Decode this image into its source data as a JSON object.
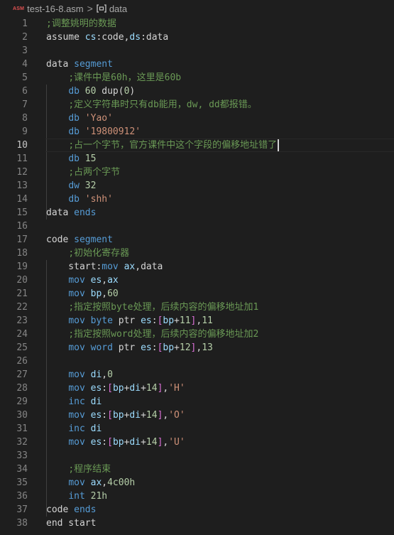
{
  "breadcrumb": {
    "file_icon": "ASM",
    "file": "test-16-8.asm",
    "separator": ">",
    "symbol": "data"
  },
  "colors": {
    "background": "#1e1e1e",
    "keyword": "#569cd6",
    "comment": "#6a9955",
    "number": "#b5cea8",
    "string": "#ce9178",
    "register": "#9cdcfe",
    "plain": "#d4d4d4",
    "bracket": "#da70d6",
    "line_number": "#858585"
  },
  "editor": {
    "current_line": 10,
    "lines": [
      {
        "n": "1",
        "tokens": [
          {
            "t": ";调整姚明的数据",
            "c": "cmt"
          }
        ]
      },
      {
        "n": "2",
        "tokens": [
          {
            "t": "assume ",
            "c": "pl"
          },
          {
            "t": "cs",
            "c": "reg"
          },
          {
            "t": ":code,",
            "c": "pl"
          },
          {
            "t": "ds",
            "c": "reg"
          },
          {
            "t": ":data",
            "c": "pl"
          }
        ]
      },
      {
        "n": "3",
        "tokens": []
      },
      {
        "n": "4",
        "tokens": [
          {
            "t": "data ",
            "c": "pl"
          },
          {
            "t": "segment",
            "c": "kw"
          }
        ]
      },
      {
        "n": "5",
        "tokens": [
          {
            "t": "    ",
            "c": "pl"
          },
          {
            "t": ";课件中是60h，这里是60b",
            "c": "cmt"
          }
        ]
      },
      {
        "n": "6",
        "tokens": [
          {
            "t": "    ",
            "c": "pl"
          },
          {
            "t": "db",
            "c": "kw"
          },
          {
            "t": " ",
            "c": "pl"
          },
          {
            "t": "60",
            "c": "num"
          },
          {
            "t": " dup(",
            "c": "pl"
          },
          {
            "t": "0",
            "c": "num"
          },
          {
            "t": ")",
            "c": "pl"
          }
        ]
      },
      {
        "n": "7",
        "tokens": [
          {
            "t": "    ",
            "c": "pl"
          },
          {
            "t": ";定义字符串时只有db能用，dw, dd都报错。",
            "c": "cmt"
          }
        ]
      },
      {
        "n": "8",
        "tokens": [
          {
            "t": "    ",
            "c": "pl"
          },
          {
            "t": "db",
            "c": "kw"
          },
          {
            "t": " ",
            "c": "pl"
          },
          {
            "t": "'Yao'",
            "c": "str"
          }
        ]
      },
      {
        "n": "9",
        "tokens": [
          {
            "t": "    ",
            "c": "pl"
          },
          {
            "t": "db",
            "c": "kw"
          },
          {
            "t": " ",
            "c": "pl"
          },
          {
            "t": "'19800912'",
            "c": "str"
          }
        ]
      },
      {
        "n": "10",
        "tokens": [
          {
            "t": "    ",
            "c": "pl"
          },
          {
            "t": ";占一个字节，官方课件中这个字段的偏移地址错了",
            "c": "cmt"
          }
        ],
        "cursor": true
      },
      {
        "n": "11",
        "tokens": [
          {
            "t": "    ",
            "c": "pl"
          },
          {
            "t": "db",
            "c": "kw"
          },
          {
            "t": " ",
            "c": "pl"
          },
          {
            "t": "15",
            "c": "num"
          }
        ]
      },
      {
        "n": "12",
        "tokens": [
          {
            "t": "    ",
            "c": "pl"
          },
          {
            "t": ";占两个字节",
            "c": "cmt"
          }
        ]
      },
      {
        "n": "13",
        "tokens": [
          {
            "t": "    ",
            "c": "pl"
          },
          {
            "t": "dw",
            "c": "kw"
          },
          {
            "t": " ",
            "c": "pl"
          },
          {
            "t": "32",
            "c": "num"
          }
        ]
      },
      {
        "n": "14",
        "tokens": [
          {
            "t": "    ",
            "c": "pl"
          },
          {
            "t": "db",
            "c": "kw"
          },
          {
            "t": " ",
            "c": "pl"
          },
          {
            "t": "'shh'",
            "c": "str"
          }
        ]
      },
      {
        "n": "15",
        "tokens": [
          {
            "t": "data ",
            "c": "pl"
          },
          {
            "t": "ends",
            "c": "kw"
          }
        ]
      },
      {
        "n": "16",
        "tokens": []
      },
      {
        "n": "17",
        "tokens": [
          {
            "t": "code ",
            "c": "pl"
          },
          {
            "t": "segment",
            "c": "kw"
          }
        ]
      },
      {
        "n": "18",
        "tokens": [
          {
            "t": "    ",
            "c": "pl"
          },
          {
            "t": ";初始化寄存器",
            "c": "cmt"
          }
        ]
      },
      {
        "n": "19",
        "tokens": [
          {
            "t": "    start:",
            "c": "pl"
          },
          {
            "t": "mov",
            "c": "kw"
          },
          {
            "t": " ",
            "c": "pl"
          },
          {
            "t": "ax",
            "c": "reg"
          },
          {
            "t": ",data",
            "c": "pl"
          }
        ]
      },
      {
        "n": "20",
        "tokens": [
          {
            "t": "    ",
            "c": "pl"
          },
          {
            "t": "mov",
            "c": "kw"
          },
          {
            "t": " ",
            "c": "pl"
          },
          {
            "t": "es",
            "c": "reg"
          },
          {
            "t": ",",
            "c": "pl"
          },
          {
            "t": "ax",
            "c": "reg"
          }
        ]
      },
      {
        "n": "21",
        "tokens": [
          {
            "t": "    ",
            "c": "pl"
          },
          {
            "t": "mov",
            "c": "kw"
          },
          {
            "t": " ",
            "c": "pl"
          },
          {
            "t": "bp",
            "c": "reg"
          },
          {
            "t": ",",
            "c": "pl"
          },
          {
            "t": "60",
            "c": "num"
          }
        ]
      },
      {
        "n": "22",
        "tokens": [
          {
            "t": "    ",
            "c": "pl"
          },
          {
            "t": ";指定按照byte处理，后续内容的偏移地址加1",
            "c": "cmt"
          }
        ]
      },
      {
        "n": "23",
        "tokens": [
          {
            "t": "    ",
            "c": "pl"
          },
          {
            "t": "mov",
            "c": "kw"
          },
          {
            "t": " ",
            "c": "pl"
          },
          {
            "t": "byte",
            "c": "kw"
          },
          {
            "t": " ptr ",
            "c": "pl"
          },
          {
            "t": "es",
            "c": "reg"
          },
          {
            "t": ":",
            "c": "pl"
          },
          {
            "t": "[",
            "c": "br"
          },
          {
            "t": "bp",
            "c": "reg"
          },
          {
            "t": "+",
            "c": "pl"
          },
          {
            "t": "11",
            "c": "num"
          },
          {
            "t": "]",
            "c": "br"
          },
          {
            "t": ",",
            "c": "pl"
          },
          {
            "t": "11",
            "c": "num"
          }
        ]
      },
      {
        "n": "24",
        "tokens": [
          {
            "t": "    ",
            "c": "pl"
          },
          {
            "t": ";指定按照word处理，后续内容的偏移地址加2",
            "c": "cmt"
          }
        ]
      },
      {
        "n": "25",
        "tokens": [
          {
            "t": "    ",
            "c": "pl"
          },
          {
            "t": "mov",
            "c": "kw"
          },
          {
            "t": " ",
            "c": "pl"
          },
          {
            "t": "word",
            "c": "kw"
          },
          {
            "t": " ptr ",
            "c": "pl"
          },
          {
            "t": "es",
            "c": "reg"
          },
          {
            "t": ":",
            "c": "pl"
          },
          {
            "t": "[",
            "c": "br"
          },
          {
            "t": "bp",
            "c": "reg"
          },
          {
            "t": "+",
            "c": "pl"
          },
          {
            "t": "12",
            "c": "num"
          },
          {
            "t": "]",
            "c": "br"
          },
          {
            "t": ",",
            "c": "pl"
          },
          {
            "t": "13",
            "c": "num"
          }
        ]
      },
      {
        "n": "26",
        "tokens": []
      },
      {
        "n": "27",
        "tokens": [
          {
            "t": "    ",
            "c": "pl"
          },
          {
            "t": "mov",
            "c": "kw"
          },
          {
            "t": " ",
            "c": "pl"
          },
          {
            "t": "di",
            "c": "reg"
          },
          {
            "t": ",",
            "c": "pl"
          },
          {
            "t": "0",
            "c": "num"
          }
        ]
      },
      {
        "n": "28",
        "tokens": [
          {
            "t": "    ",
            "c": "pl"
          },
          {
            "t": "mov",
            "c": "kw"
          },
          {
            "t": " ",
            "c": "pl"
          },
          {
            "t": "es",
            "c": "reg"
          },
          {
            "t": ":",
            "c": "pl"
          },
          {
            "t": "[",
            "c": "br"
          },
          {
            "t": "bp",
            "c": "reg"
          },
          {
            "t": "+",
            "c": "pl"
          },
          {
            "t": "di",
            "c": "reg"
          },
          {
            "t": "+",
            "c": "pl"
          },
          {
            "t": "14",
            "c": "num"
          },
          {
            "t": "]",
            "c": "br"
          },
          {
            "t": ",",
            "c": "pl"
          },
          {
            "t": "'H'",
            "c": "str"
          }
        ]
      },
      {
        "n": "29",
        "tokens": [
          {
            "t": "    ",
            "c": "pl"
          },
          {
            "t": "inc",
            "c": "kw"
          },
          {
            "t": " ",
            "c": "pl"
          },
          {
            "t": "di",
            "c": "reg"
          }
        ]
      },
      {
        "n": "30",
        "tokens": [
          {
            "t": "    ",
            "c": "pl"
          },
          {
            "t": "mov",
            "c": "kw"
          },
          {
            "t": " ",
            "c": "pl"
          },
          {
            "t": "es",
            "c": "reg"
          },
          {
            "t": ":",
            "c": "pl"
          },
          {
            "t": "[",
            "c": "br"
          },
          {
            "t": "bp",
            "c": "reg"
          },
          {
            "t": "+",
            "c": "pl"
          },
          {
            "t": "di",
            "c": "reg"
          },
          {
            "t": "+",
            "c": "pl"
          },
          {
            "t": "14",
            "c": "num"
          },
          {
            "t": "]",
            "c": "br"
          },
          {
            "t": ",",
            "c": "pl"
          },
          {
            "t": "'O'",
            "c": "str"
          }
        ]
      },
      {
        "n": "31",
        "tokens": [
          {
            "t": "    ",
            "c": "pl"
          },
          {
            "t": "inc",
            "c": "kw"
          },
          {
            "t": " ",
            "c": "pl"
          },
          {
            "t": "di",
            "c": "reg"
          }
        ]
      },
      {
        "n": "32",
        "tokens": [
          {
            "t": "    ",
            "c": "pl"
          },
          {
            "t": "mov",
            "c": "kw"
          },
          {
            "t": " ",
            "c": "pl"
          },
          {
            "t": "es",
            "c": "reg"
          },
          {
            "t": ":",
            "c": "pl"
          },
          {
            "t": "[",
            "c": "br"
          },
          {
            "t": "bp",
            "c": "reg"
          },
          {
            "t": "+",
            "c": "pl"
          },
          {
            "t": "di",
            "c": "reg"
          },
          {
            "t": "+",
            "c": "pl"
          },
          {
            "t": "14",
            "c": "num"
          },
          {
            "t": "]",
            "c": "br"
          },
          {
            "t": ",",
            "c": "pl"
          },
          {
            "t": "'U'",
            "c": "str"
          }
        ]
      },
      {
        "n": "33",
        "tokens": []
      },
      {
        "n": "34",
        "tokens": [
          {
            "t": "    ",
            "c": "pl"
          },
          {
            "t": ";程序结束",
            "c": "cmt"
          }
        ]
      },
      {
        "n": "35",
        "tokens": [
          {
            "t": "    ",
            "c": "pl"
          },
          {
            "t": "mov",
            "c": "kw"
          },
          {
            "t": " ",
            "c": "pl"
          },
          {
            "t": "ax",
            "c": "reg"
          },
          {
            "t": ",",
            "c": "pl"
          },
          {
            "t": "4c00h",
            "c": "num"
          }
        ]
      },
      {
        "n": "36",
        "tokens": [
          {
            "t": "    ",
            "c": "pl"
          },
          {
            "t": "int",
            "c": "kw"
          },
          {
            "t": " ",
            "c": "pl"
          },
          {
            "t": "21h",
            "c": "num"
          }
        ]
      },
      {
        "n": "37",
        "tokens": [
          {
            "t": "code ",
            "c": "pl"
          },
          {
            "t": "ends",
            "c": "kw"
          }
        ]
      },
      {
        "n": "38",
        "tokens": [
          {
            "t": "end start",
            "c": "pl"
          }
        ]
      }
    ]
  }
}
